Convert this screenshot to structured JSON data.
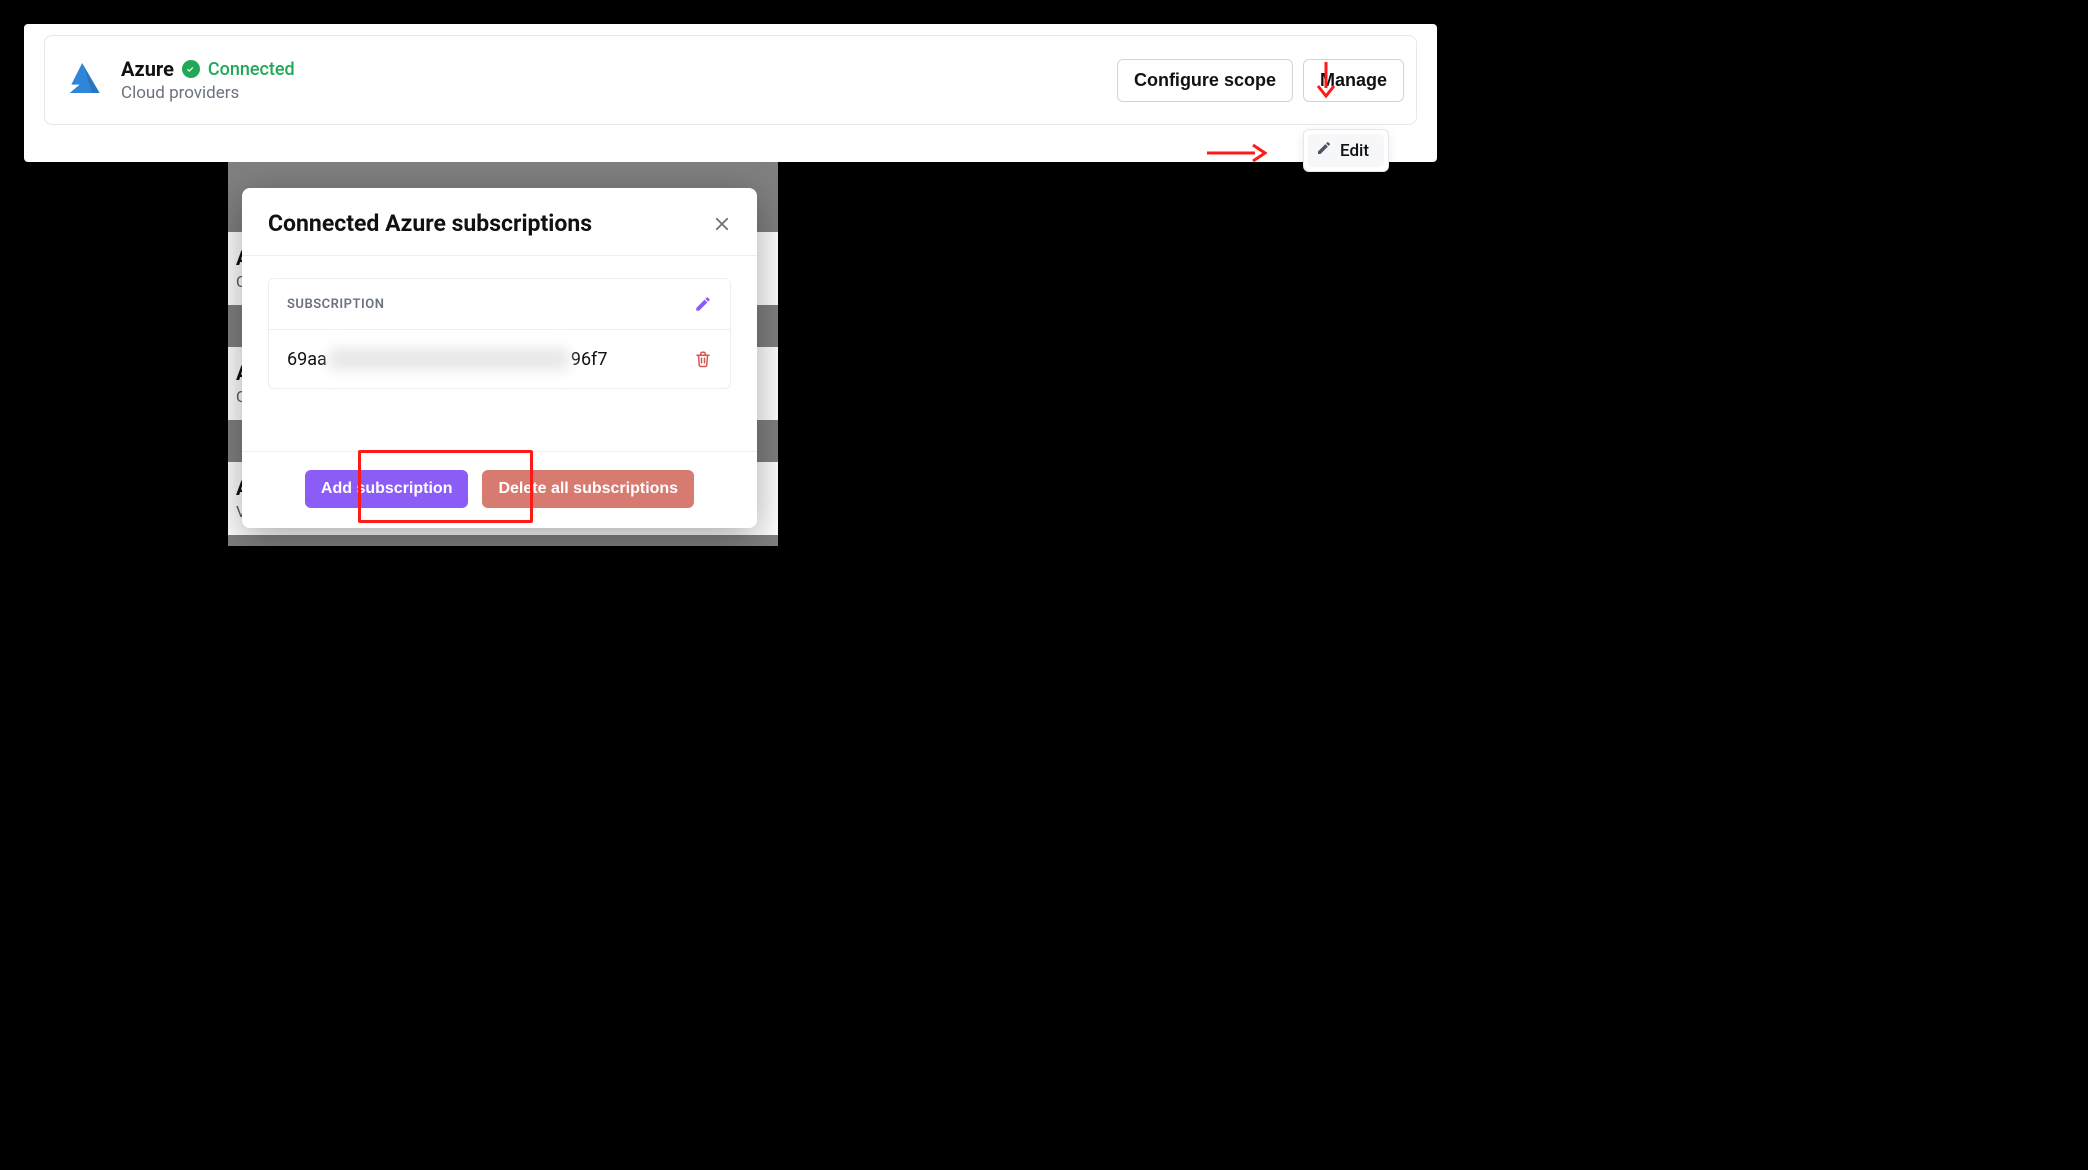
{
  "provider": {
    "name": "Azure",
    "status": "Connected",
    "category": "Cloud providers"
  },
  "actions": {
    "configure_scope": "Configure scope",
    "manage": "Manage"
  },
  "dropdown": {
    "edit": "Edit"
  },
  "modal": {
    "title": "Connected Azure subscriptions",
    "column_header": "SUBSCRIPTION",
    "subscription_prefix": "69aa",
    "subscription_suffix": "96f7",
    "add_button": "Add subscription",
    "delete_all_button": "Delete all subscriptions"
  },
  "background_items": [
    {
      "title_initial": "A",
      "sub_initial": "C"
    },
    {
      "title_initial": "A",
      "sub_initial": "C"
    },
    {
      "title_initial": "A",
      "sub_initial": "Ve"
    }
  ]
}
